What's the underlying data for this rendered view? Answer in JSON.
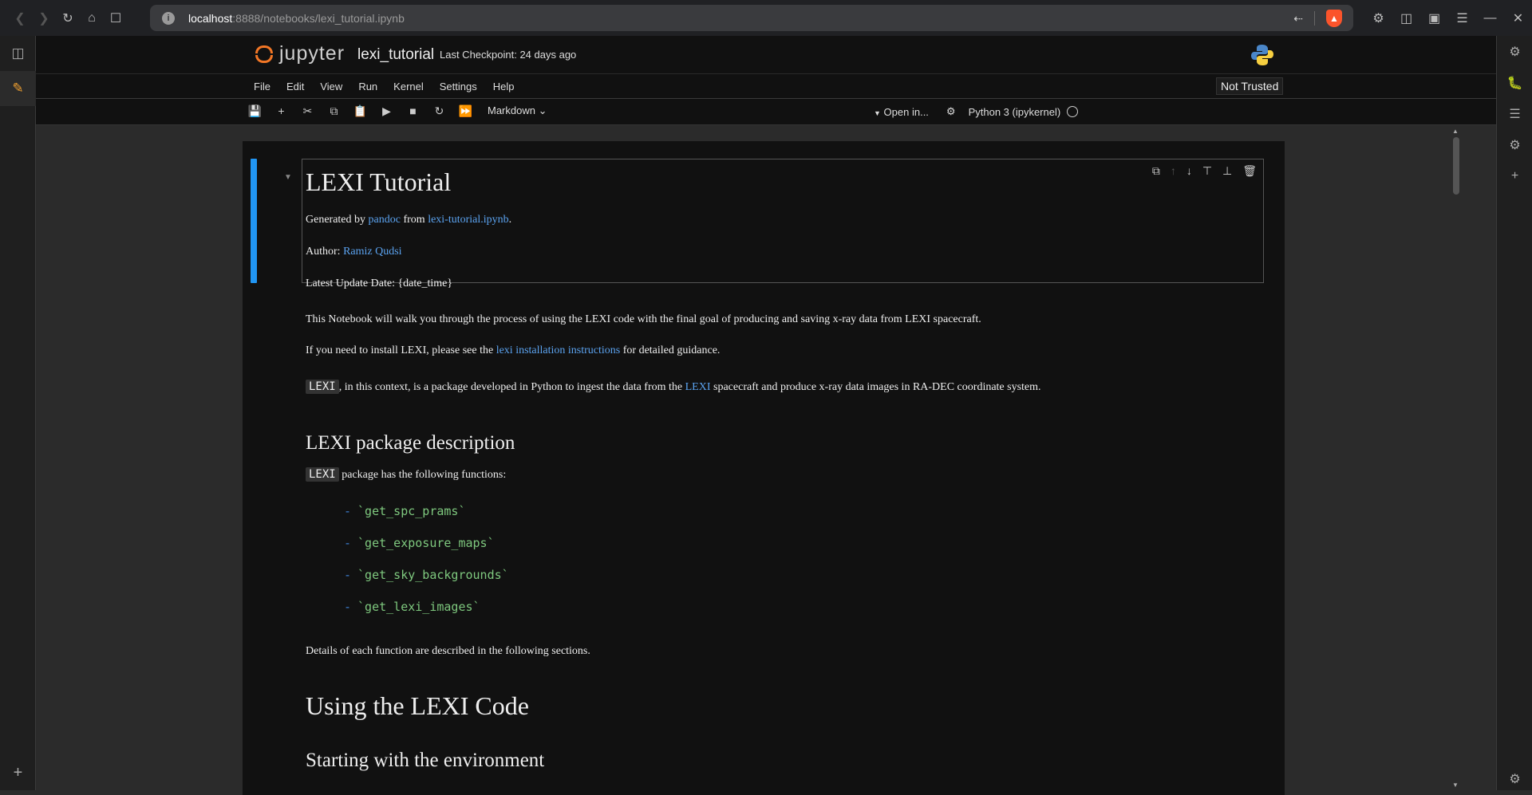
{
  "browser": {
    "url_host": "localhost",
    "url_path": ":8888/notebooks/lexi_tutorial.ipynb"
  },
  "header": {
    "logo_text": "jupyter",
    "notebook_title": "lexi_tutorial",
    "checkpoint": "Last Checkpoint: 24 days ago"
  },
  "menu": [
    "File",
    "Edit",
    "View",
    "Run",
    "Kernel",
    "Settings",
    "Help"
  ],
  "trust_status": "Not Trusted",
  "toolbar": {
    "cell_type": "Markdown",
    "open_in": "Open in...",
    "kernel_name": "Python 3 (ipykernel)"
  },
  "notebook": {
    "title": "LEXI Tutorial",
    "generated_prefix": "Generated by ",
    "generated_tool": "pandoc",
    "generated_mid": " from ",
    "generated_file": "lexi-tutorial.ipynb",
    "generated_end": ".",
    "author_label": "Author: ",
    "author_name": "Ramiz Qudsi",
    "update_date": "Latest Update Date: {date_time}",
    "intro": "This Notebook will walk you through the process of using the LEXI code with the final goal of producing and saving x-ray data from LEXI spacecraft.",
    "install_prefix": "If you need to install LEXI, please see the ",
    "install_link": "lexi installation instructions",
    "install_suffix": " for detailed guidance.",
    "context_code": "LEXI",
    "context_mid": ", in this context, is a package developed in Python to ingest the data from the ",
    "context_link": "LEXI",
    "context_suffix": " spacecraft and produce x-ray data images in RA-DEC coordinate system.",
    "pkg_heading": "LEXI package description",
    "pkg_code": "LEXI",
    "pkg_text": " package has the following functions:",
    "functions": [
      "`get_spc_prams`",
      "`get_exposure_maps`",
      "`get_sky_backgrounds`",
      "`get_lexi_images`"
    ],
    "details": "Details of each function are described in the following sections.",
    "using_heading": "Using the LEXI Code",
    "env_heading": "Starting with the environment"
  }
}
